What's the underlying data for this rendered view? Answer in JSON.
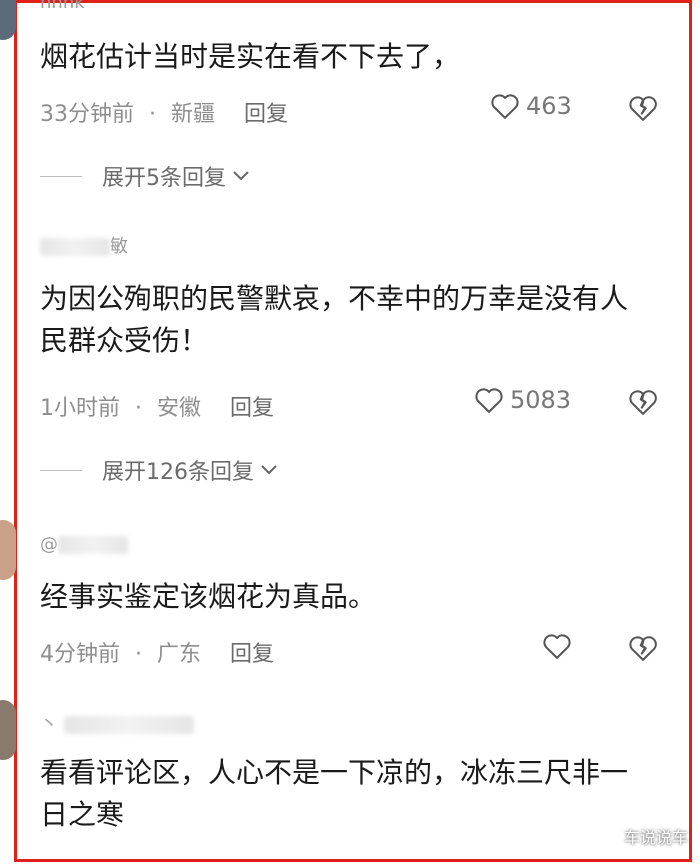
{
  "comments": [
    {
      "username": "hhhk",
      "text": "烟花估计当时是实在看不下去了，",
      "time": "33分钟前",
      "location": "新疆",
      "reply_label": "回复",
      "likes": "463",
      "expand_label": "展开5条回复"
    },
    {
      "username": "敏",
      "text": "为因公殉职的民警默哀，不幸中的万幸是没有人民群众受伤！",
      "time": "1小时前",
      "location": "安徽",
      "reply_label": "回复",
      "likes": "5083",
      "expand_label": "展开126条回复"
    },
    {
      "username": "@",
      "text": "经事实鉴定该烟花为真品。",
      "time": "4分钟前",
      "location": "广东",
      "reply_label": "回复",
      "likes": ""
    },
    {
      "username": "丶",
      "text": "看看评论区，人心不是一下凉的，冰冻三尺非一日之寒",
      "time": "",
      "location": "",
      "reply_label": ""
    }
  ],
  "separator": "·",
  "watermark": "车说说车",
  "colors": {
    "frame": "#e0201b",
    "meta": "#8e8e8e",
    "text": "#1a1a1a"
  },
  "icons": {
    "like": "heart-outline-icon",
    "dislike": "broken-heart-icon",
    "expand": "chevron-down-icon"
  }
}
